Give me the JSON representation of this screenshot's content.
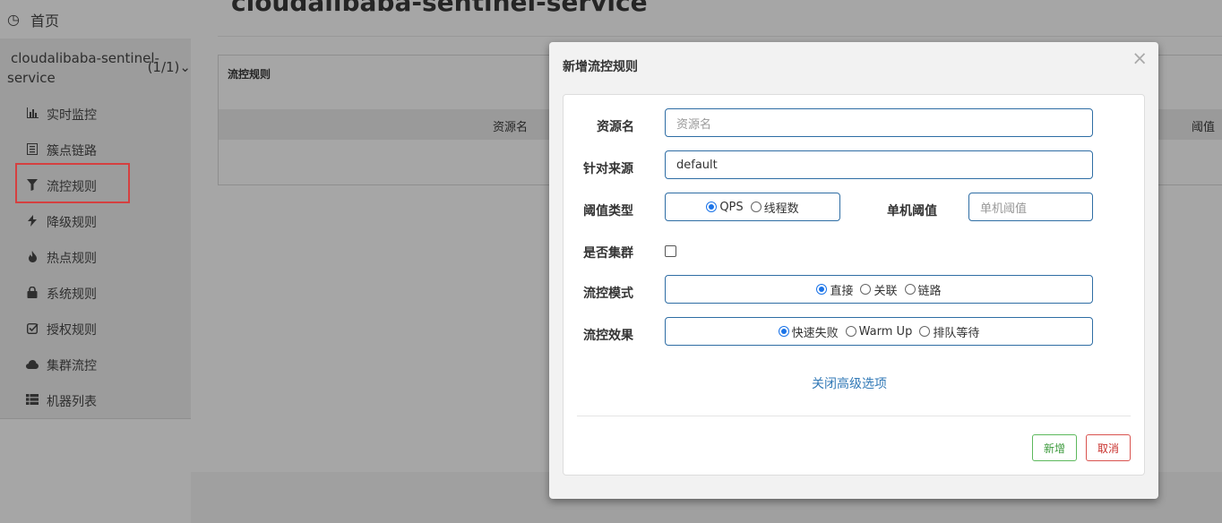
{
  "sidebar": {
    "home_label": "首页",
    "app_name_line1": "cloudalibaba-sentinel-",
    "app_name_line2": "service",
    "app_count": "(1/1)",
    "items": [
      {
        "label": "实时监控",
        "icon": "bar-chart-icon"
      },
      {
        "label": "簇点链路",
        "icon": "list-icon"
      },
      {
        "label": "流控规则",
        "icon": "filter-icon"
      },
      {
        "label": "降级规则",
        "icon": "flash-icon"
      },
      {
        "label": "热点规则",
        "icon": "fire-icon"
      },
      {
        "label": "系统规则",
        "icon": "lock-icon"
      },
      {
        "label": "授权规则",
        "icon": "check-icon"
      },
      {
        "label": "集群流控",
        "icon": "cloud-icon"
      },
      {
        "label": "机器列表",
        "icon": "th-list-icon"
      }
    ]
  },
  "main": {
    "page_title": "cloudalibaba-sentinel-service",
    "panel_title": "流控规则",
    "columns": [
      "资源名",
      "阈值"
    ]
  },
  "modal": {
    "title": "新增流控规则",
    "close": "×",
    "fields": {
      "resource_label": "资源名",
      "resource_placeholder": "资源名",
      "origin_label": "针对来源",
      "origin_value": "default",
      "threshold_type_label": "阈值类型",
      "threshold_type_options": [
        "QPS",
        "线程数"
      ],
      "threshold_type_selected": "QPS",
      "single_threshold_label": "单机阈值",
      "single_threshold_placeholder": "单机阈值",
      "cluster_label": "是否集群",
      "cluster_checked": false,
      "mode_label": "流控模式",
      "mode_options": [
        "直接",
        "关联",
        "链路"
      ],
      "mode_selected": "直接",
      "effect_label": "流控效果",
      "effect_options": [
        "快速失败",
        "Warm Up",
        "排队等待"
      ],
      "effect_selected": "快速失败"
    },
    "advanced_link": "关闭高级选项",
    "add_button": "新增",
    "cancel_button": "取消"
  },
  "colors": {
    "accent": "#337ab7",
    "input_border": "#2e6da4",
    "highlight": "#d54040",
    "success": "#5cb85c",
    "danger": "#d9534f"
  }
}
